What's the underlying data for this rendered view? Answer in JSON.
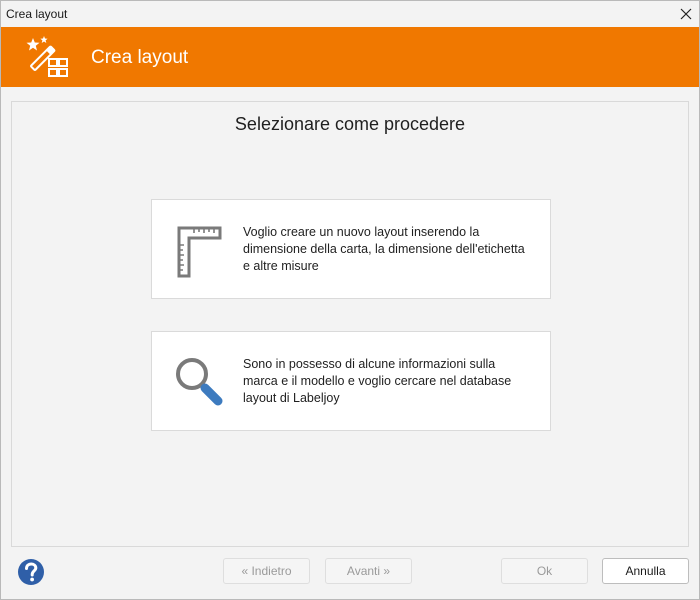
{
  "window": {
    "title": "Crea layout"
  },
  "header": {
    "title": "Crea layout",
    "accent_color": "#f07800",
    "icon": "magic-wand-grid-icon"
  },
  "main": {
    "heading": "Selezionare come procedere",
    "options": [
      {
        "icon": "ruler-square-icon",
        "text": "Voglio creare un nuovo layout inserendo la dimensione della carta, la dimensione dell'etichetta e altre misure"
      },
      {
        "icon": "magnifier-icon",
        "text": "Sono in possesso di alcune informazioni sulla marca e il modello e voglio cercare nel database layout di Labeljoy"
      }
    ]
  },
  "footer": {
    "help_icon": "help-icon",
    "back_label": "« Indietro",
    "next_label": "Avanti »",
    "ok_label": "Ok",
    "cancel_label": "Annulla"
  }
}
